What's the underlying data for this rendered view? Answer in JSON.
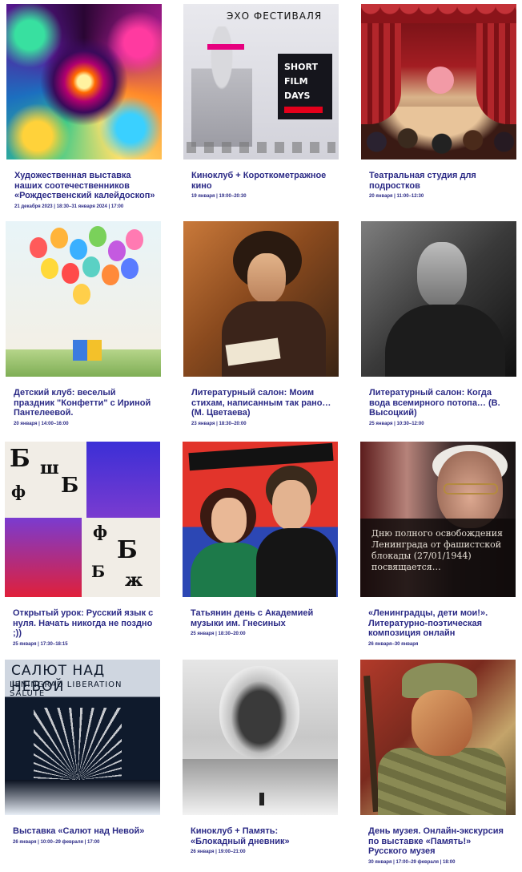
{
  "events": [
    {
      "title": "Художественная выставка наших соотечественников «Рождественский калейдоскоп»",
      "date": "21 декабря 2023 | 18:30–31 января 2024 | 17:00",
      "image": "fractal"
    },
    {
      "title": "Киноклуб + Короткометражное кино",
      "date": "19 января | 19:00–20:30",
      "image": "festival"
    },
    {
      "title": "Театральная студия для подростков",
      "date": "20 января | 11:00–12:30",
      "image": "theatre"
    },
    {
      "title": "Детский клуб: веселый праздник \"Конфетти\" с Ириной Пантелеевой.",
      "date": "20 января | 14:00–16:00",
      "image": "balloons"
    },
    {
      "title": "Литературный салон: Моим стихам, написанным так рано… (М. Цветаева)",
      "date": "23 января | 18:30–20:00",
      "image": "writer"
    },
    {
      "title": "Литературный салон: Когда вода всемирного потопа… (В. Высоцкий)",
      "date": "25 января | 10:30–12:00",
      "image": "portrait-bw"
    },
    {
      "title": "Открытый урок: Русский язык с нуля. Начать никогда не поздно ;))",
      "date": "25 января | 17:30–18:15",
      "image": "letters"
    },
    {
      "title": "Татьянин день с Академией музыки им. Гнесиных",
      "date": "25 января | 18:30–20:00",
      "image": "duo"
    },
    {
      "title": "«Ленинградцы, дети мои!». Литературно-поэтическая композиция онлайн",
      "date": "26 января–30 января",
      "image": "blockade"
    },
    {
      "title": "Выставка «Салют над Невой»",
      "date": "26 января | 10:00–29 февраля | 17:00",
      "image": "salute"
    },
    {
      "title": "Киноклуб + Память: «Блокадный дневник»",
      "date": "26 января | 19:00–21:00",
      "image": "snow"
    },
    {
      "title": "День музея. Онлайн-экскурсия по выставке «Память!» Русского музея",
      "date": "30 января | 17:00–29 февраля | 18:00",
      "image": "soldier"
    }
  ],
  "image_text": {
    "festival_title": "ЭХО ФЕСТИВАЛЯ",
    "festival_badge": [
      "SHORT",
      "FILM",
      "DAYS"
    ],
    "blockade_caption": "Дню полного освобождения Ленинграда от фашистской блокады (27/01/1944) посвящается…",
    "salute_title": "САЛЮТ НАД НЕВОЙ",
    "salute_subtitle": "LENINGRAD LIBERATION SALUTE"
  },
  "colors": {
    "accent_text": "#2b2a86",
    "background": "#ffffff"
  }
}
